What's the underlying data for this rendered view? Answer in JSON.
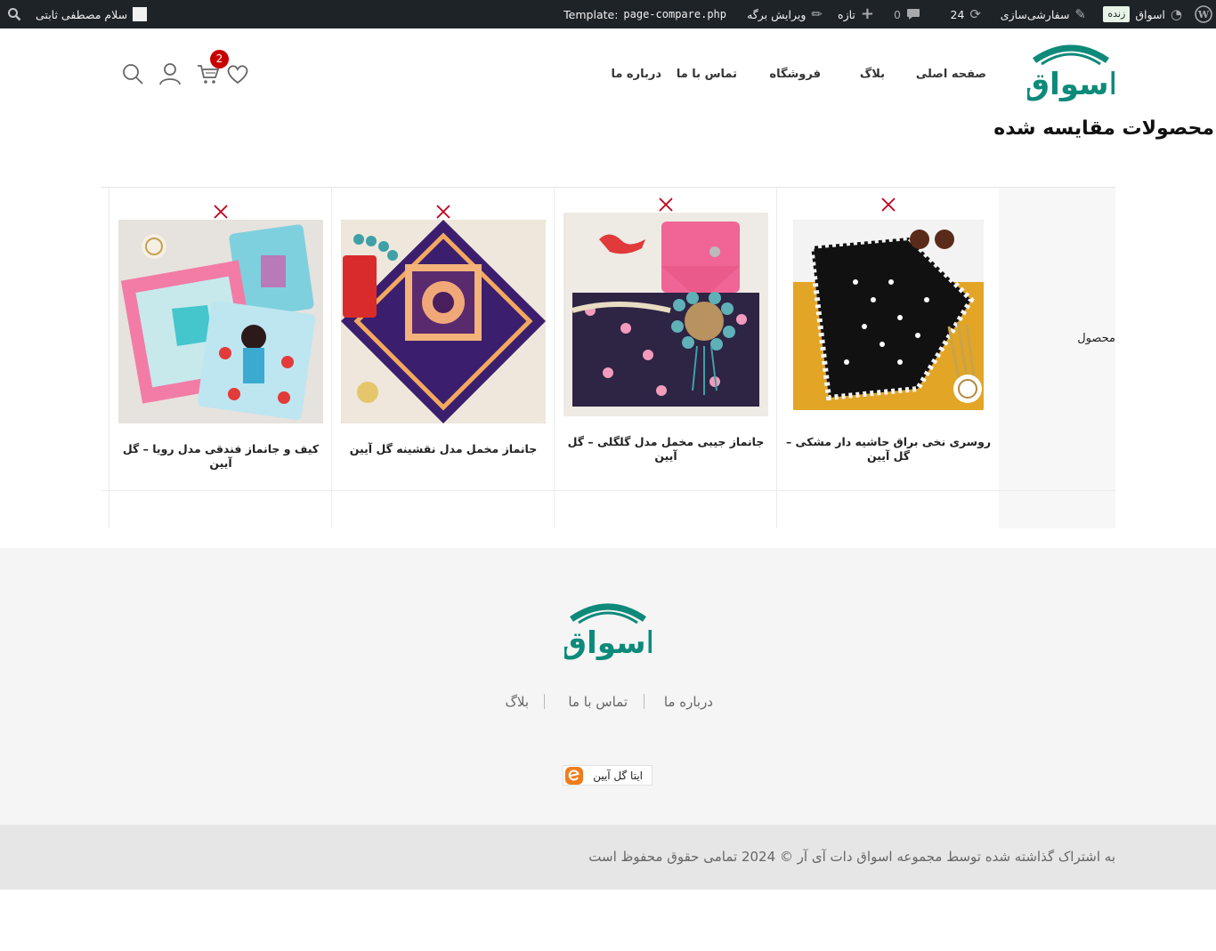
{
  "admin_bar": {
    "site_name": "اسواق",
    "live_badge": "زنده",
    "customize": "سفارشی‌سازی",
    "updates_count": "24",
    "comments_count": "0",
    "new": "تازه",
    "edit_page": "ویرایش برگه",
    "template_label": "Template:",
    "template_file": "page-compare.php",
    "greeting": "سلام مصطفی ثابتی"
  },
  "header": {
    "logo_text": "اسواق",
    "nav": [
      "صفحه اصلی",
      "بلاگ",
      "فروشگاه",
      "تماس با ما",
      "درباره ما"
    ],
    "cart_count": "2",
    "brand_color": "#0d8a7a"
  },
  "page_title": "محصولات مقایسه شده",
  "compare": {
    "row_label": "محصول",
    "products": [
      {
        "name": "روسری نخی براق حاشیه دار مشکی – گل آیین"
      },
      {
        "name": "جانماز جیبی مخمل مدل گلگلی – گل آیین"
      },
      {
        "name": "جانماز مخمل مدل نقشینه گل آیین"
      },
      {
        "name": "کیف و جانماز فندقی مدل رویا – گل آیین"
      }
    ]
  },
  "footer": {
    "logo_text": "اسواق",
    "links": [
      "درباره ما",
      "تماس با ما",
      "بلاگ"
    ],
    "eita_label": "ایتا گل آیین",
    "copyright": "به اشتراک گذاشته شده توسط مجموعه اسواق دات آی آر © 2024 تمامی حقوق محفوظ است"
  }
}
